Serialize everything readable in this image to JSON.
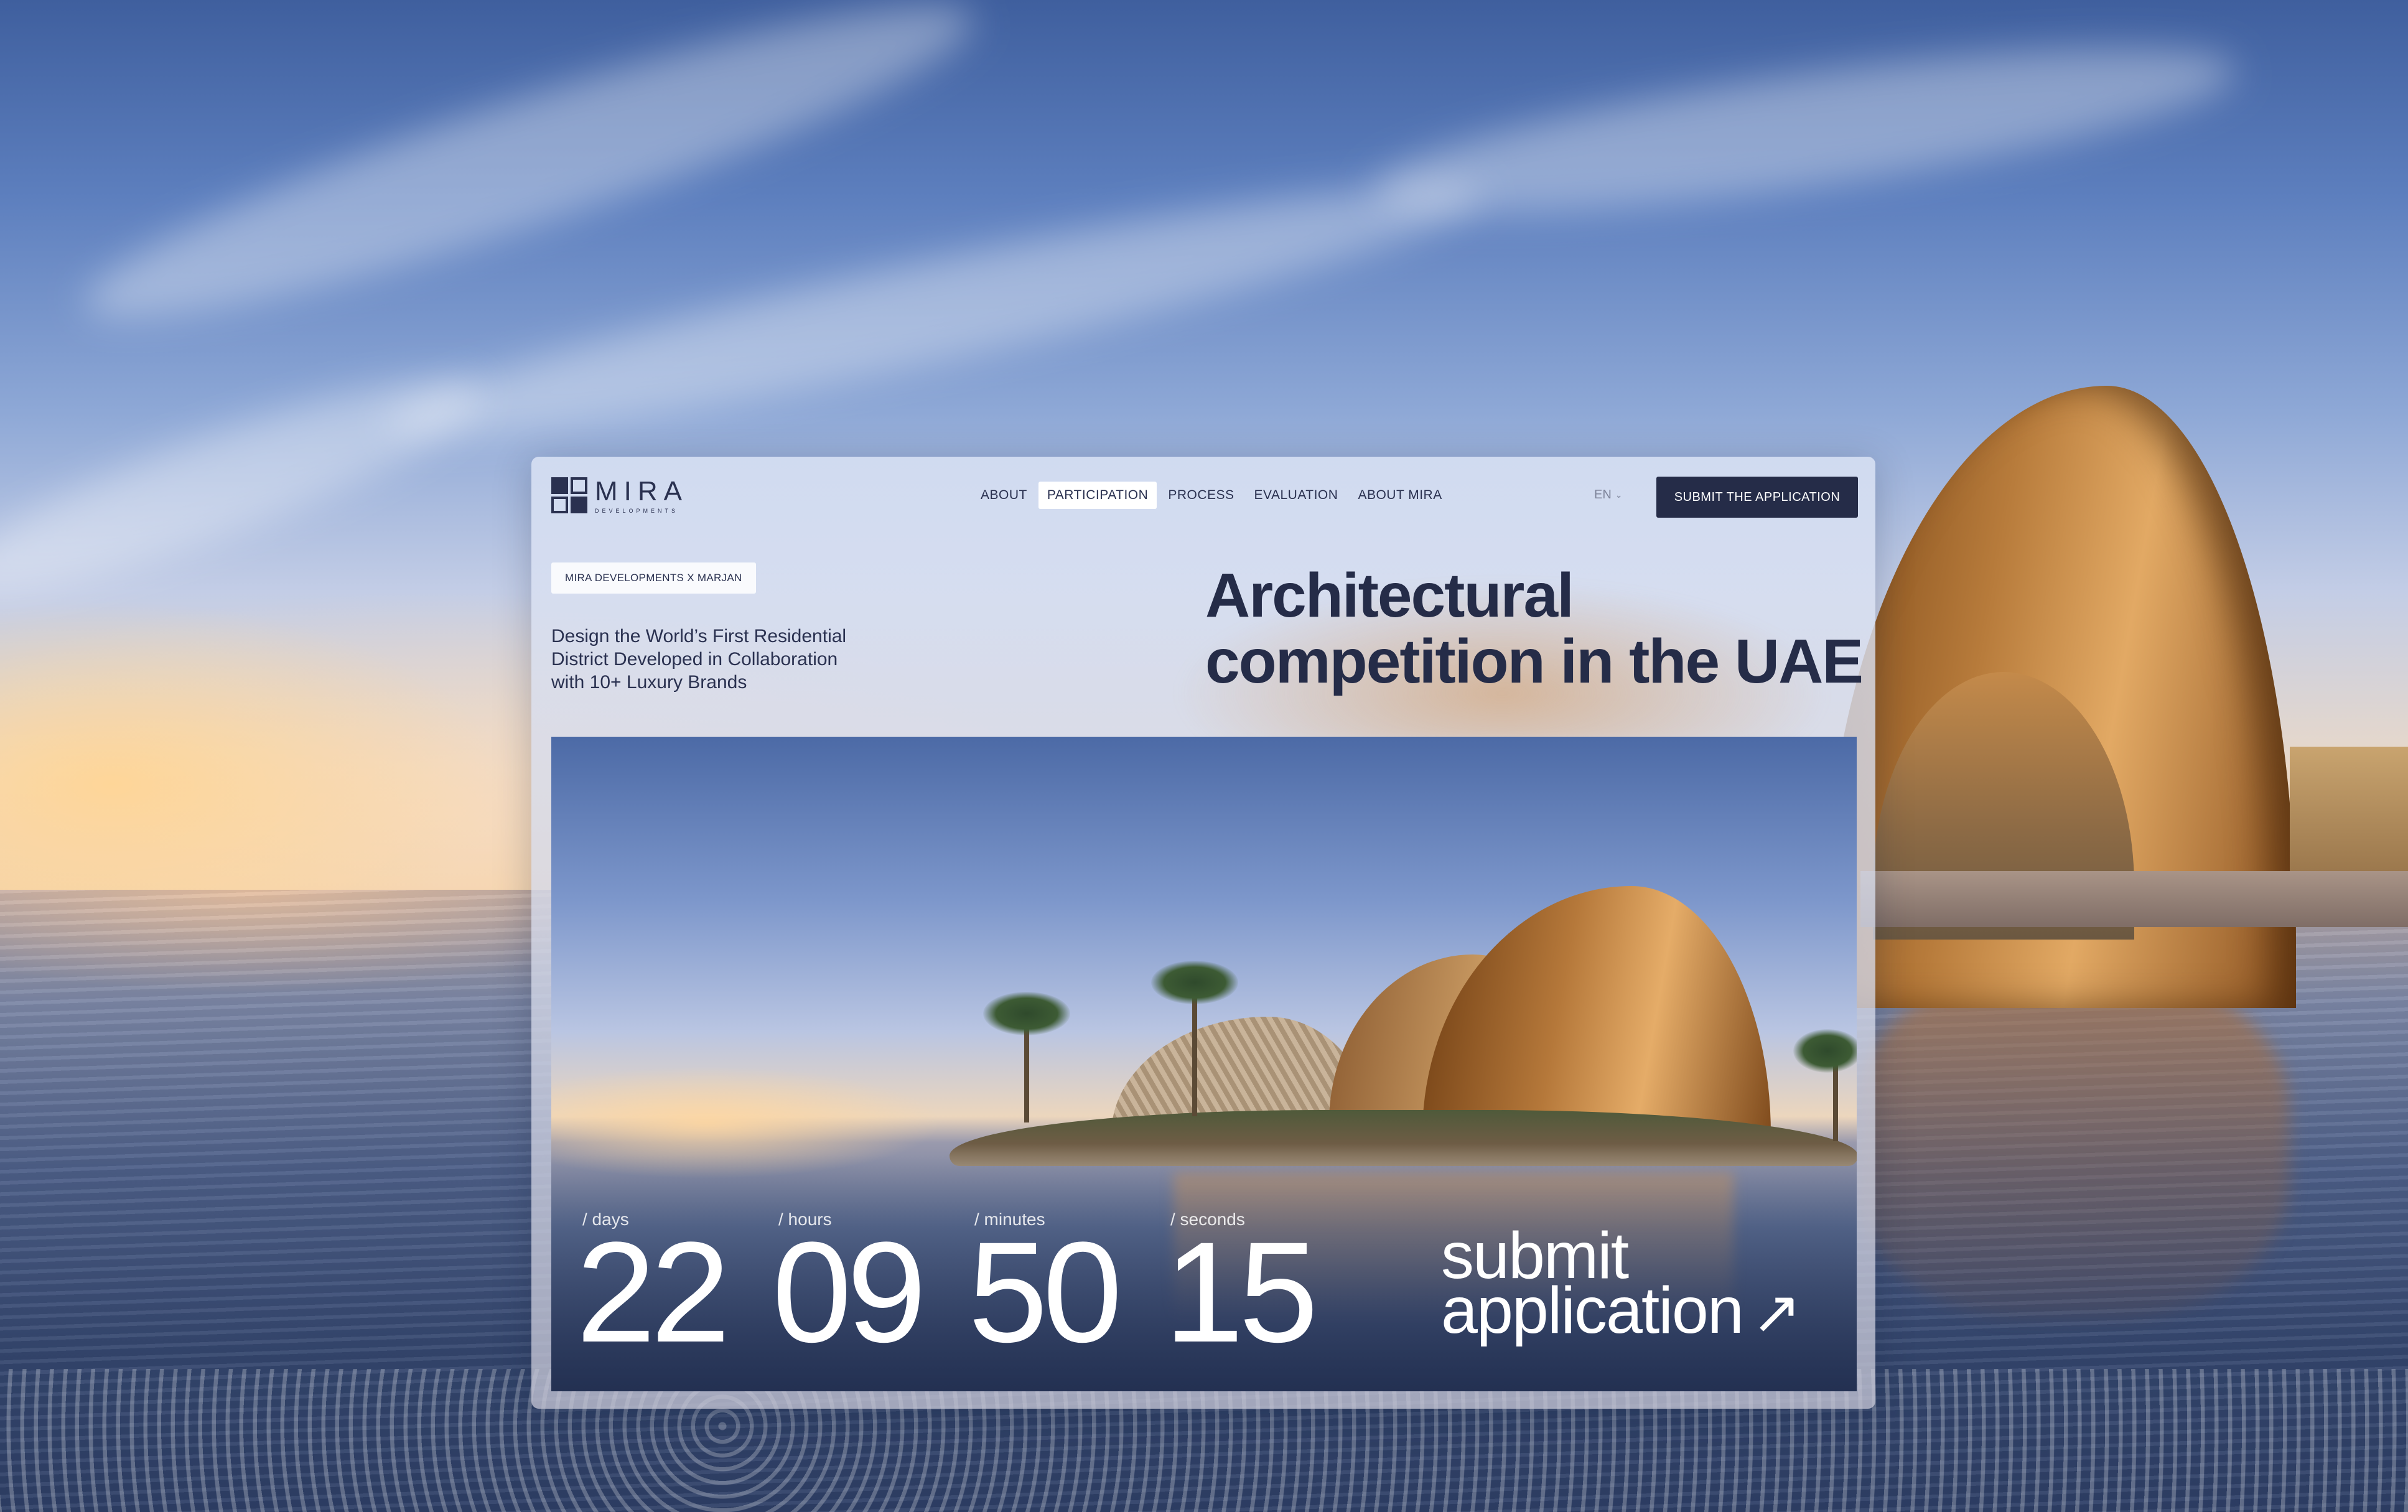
{
  "brand": {
    "name": "MIRA",
    "subtitle": "DEVELOPMENTS"
  },
  "nav": {
    "items": [
      {
        "label": "ABOUT",
        "active": false
      },
      {
        "label": "PARTICIPATION",
        "active": true
      },
      {
        "label": "PROCESS",
        "active": false
      },
      {
        "label": "EVALUATION",
        "active": false
      },
      {
        "label": "ABOUT MIRA",
        "active": false
      }
    ],
    "language": "EN",
    "cta_label": "SUBMIT THE APPLICATION"
  },
  "hero": {
    "tag": "MIRA DEVELOPMENTS X MARJAN",
    "lead": "Design the World’s First Residential District Developed in Collaboration with 10+ Luxury Brands",
    "headline_line1": "Architectural",
    "headline_line2": "competition in the UAE"
  },
  "countdown": {
    "days": {
      "label": "/ days",
      "value": "22"
    },
    "hours": {
      "label": "/ hours",
      "value": "09"
    },
    "minutes": {
      "label": "/ minutes",
      "value": "50"
    },
    "seconds": {
      "label": "/ seconds",
      "value": "15"
    }
  },
  "submit": {
    "line1": "submit",
    "line2": "application",
    "arrow": "↗"
  },
  "colors": {
    "primary_navy": "#252c48",
    "text_navy": "#2a3150",
    "muted": "#7d8399",
    "white": "#ffffff"
  }
}
